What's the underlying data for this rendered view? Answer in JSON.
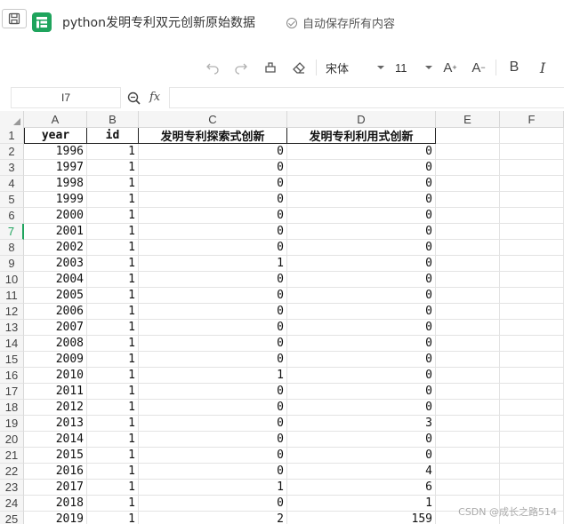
{
  "titlebar": {
    "doc_title": "python发明专利双元创新原始数据",
    "autosave": "自动保存所有内容"
  },
  "toolbar": {
    "font_name": "宋体",
    "font_size": "11",
    "bold_label": "B",
    "italic_label": "I"
  },
  "formulabar": {
    "cell_ref": "I7",
    "fx_label": "fx",
    "formula": ""
  },
  "columns": [
    "A",
    "B",
    "C",
    "D",
    "E",
    "F"
  ],
  "active_row": 7,
  "rows": [
    {
      "n": "1",
      "cells": [
        "year",
        "id",
        "发明专利探索式创新",
        "发明专利利用式创新"
      ]
    },
    {
      "n": "2",
      "cells": [
        "1996",
        "1",
        "0",
        "0"
      ]
    },
    {
      "n": "3",
      "cells": [
        "1997",
        "1",
        "0",
        "0"
      ]
    },
    {
      "n": "4",
      "cells": [
        "1998",
        "1",
        "0",
        "0"
      ]
    },
    {
      "n": "5",
      "cells": [
        "1999",
        "1",
        "0",
        "0"
      ]
    },
    {
      "n": "6",
      "cells": [
        "2000",
        "1",
        "0",
        "0"
      ]
    },
    {
      "n": "7",
      "cells": [
        "2001",
        "1",
        "0",
        "0"
      ]
    },
    {
      "n": "8",
      "cells": [
        "2002",
        "1",
        "0",
        "0"
      ]
    },
    {
      "n": "9",
      "cells": [
        "2003",
        "1",
        "1",
        "0"
      ]
    },
    {
      "n": "10",
      "cells": [
        "2004",
        "1",
        "0",
        "0"
      ]
    },
    {
      "n": "11",
      "cells": [
        "2005",
        "1",
        "0",
        "0"
      ]
    },
    {
      "n": "12",
      "cells": [
        "2006",
        "1",
        "0",
        "0"
      ]
    },
    {
      "n": "13",
      "cells": [
        "2007",
        "1",
        "0",
        "0"
      ]
    },
    {
      "n": "14",
      "cells": [
        "2008",
        "1",
        "0",
        "0"
      ]
    },
    {
      "n": "15",
      "cells": [
        "2009",
        "1",
        "0",
        "0"
      ]
    },
    {
      "n": "16",
      "cells": [
        "2010",
        "1",
        "1",
        "0"
      ]
    },
    {
      "n": "17",
      "cells": [
        "2011",
        "1",
        "0",
        "0"
      ]
    },
    {
      "n": "18",
      "cells": [
        "2012",
        "1",
        "0",
        "0"
      ]
    },
    {
      "n": "19",
      "cells": [
        "2013",
        "1",
        "0",
        "3"
      ]
    },
    {
      "n": "20",
      "cells": [
        "2014",
        "1",
        "0",
        "0"
      ]
    },
    {
      "n": "21",
      "cells": [
        "2015",
        "1",
        "0",
        "0"
      ]
    },
    {
      "n": "22",
      "cells": [
        "2016",
        "1",
        "0",
        "4"
      ]
    },
    {
      "n": "23",
      "cells": [
        "2017",
        "1",
        "1",
        "6"
      ]
    },
    {
      "n": "24",
      "cells": [
        "2018",
        "1",
        "0",
        "1"
      ]
    },
    {
      "n": "25",
      "cells": [
        "2019",
        "1",
        "2",
        "159"
      ]
    }
  ],
  "watermark": "CSDN @成长之路514"
}
